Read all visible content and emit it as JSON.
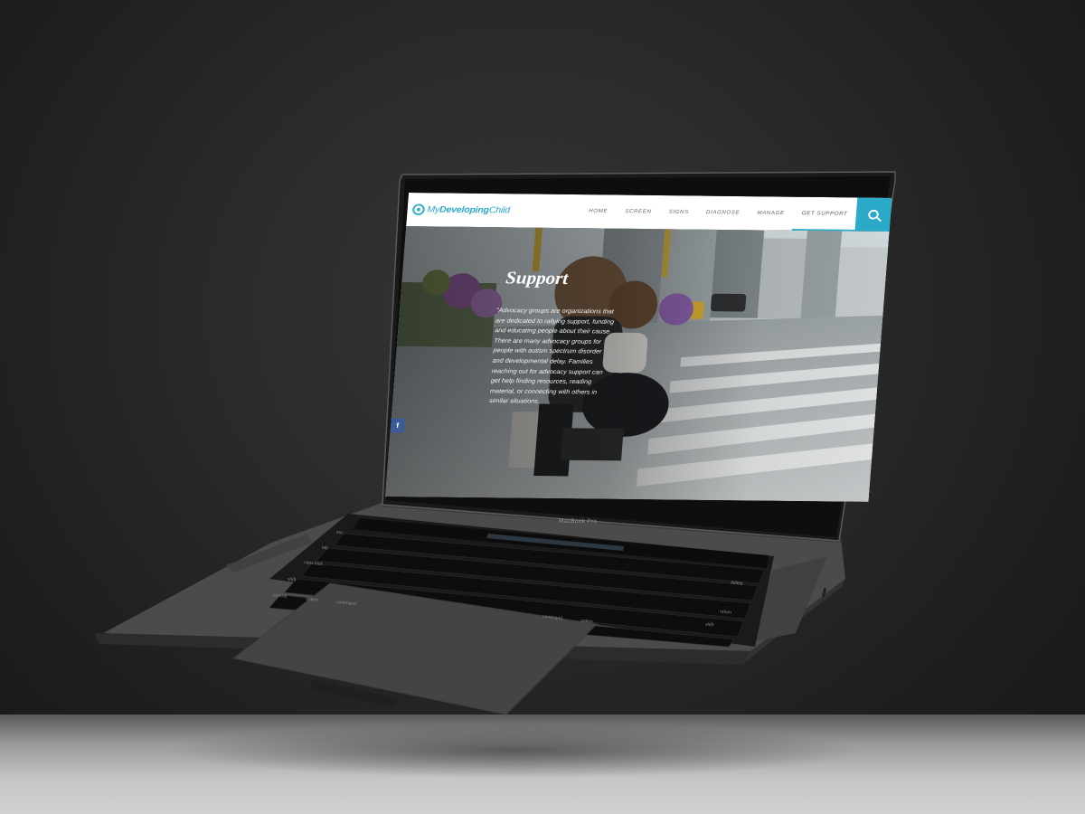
{
  "device": {
    "label": "MacBook Pro",
    "keys": {
      "esc": "esc",
      "tab": "tab",
      "caps_lock": "caps lock",
      "shift_left": "shift",
      "control": "control",
      "option_left": "option",
      "command_left": "command",
      "command_right": "command",
      "option_right": "option",
      "delete": "delete",
      "return": "return",
      "shift_right": "shift"
    }
  },
  "site": {
    "logo": {
      "prefix": "My",
      "bold": "Developing",
      "suffix": "Child"
    },
    "nav": [
      {
        "label": "HOME"
      },
      {
        "label": "SCREEN"
      },
      {
        "label": "SIGNS"
      },
      {
        "label": "DIAGNOSE"
      },
      {
        "label": "MANAGE"
      },
      {
        "label": "GET SUPPORT"
      }
    ],
    "search_icon": "search-icon",
    "hero": {
      "title": "Support",
      "text": "\"Advocacy groups are organizations that are dedicated to rallying support, funding and educating people about their cause. There are many advocacy groups for people with autism spectrum disorder and developmental delay. Families reaching out for advocacy support can get help finding resources, reading material, or connecting with others in similar situations."
    },
    "social": {
      "facebook_label": "f"
    },
    "colors": {
      "accent": "#2ba9c9",
      "facebook": "#3b5b99"
    }
  }
}
